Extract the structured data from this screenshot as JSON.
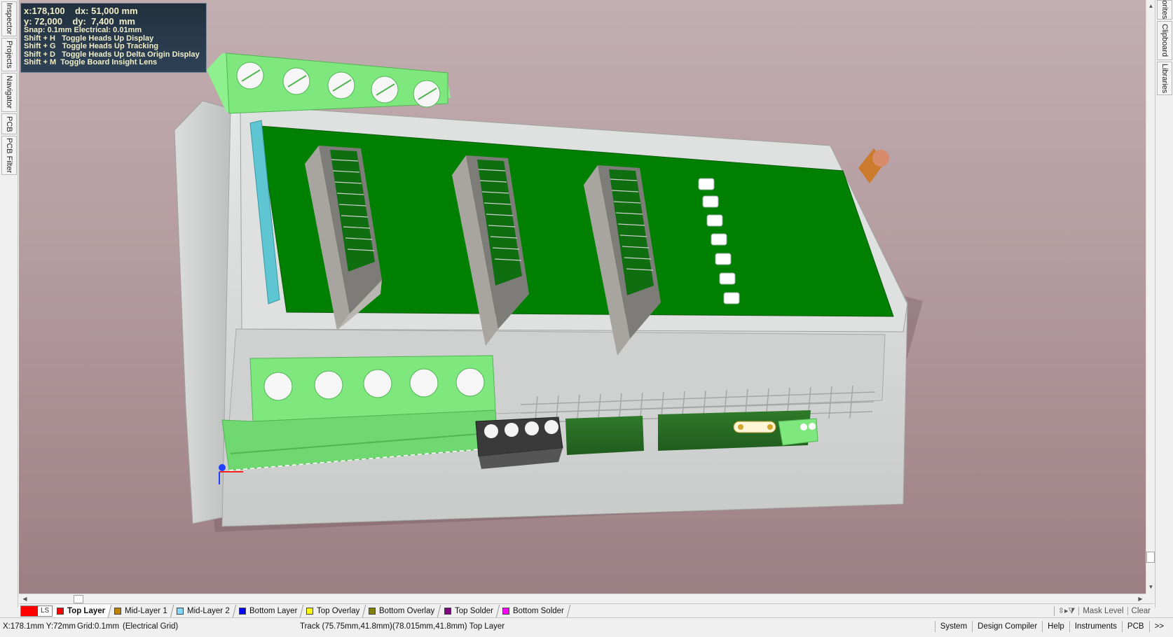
{
  "side_tabs_left": [
    "Inspector",
    "Projects",
    "Navigator",
    "PCB",
    "PCB Filter"
  ],
  "side_tabs_right": [
    "Favorites",
    "Clipboard",
    "Libraries"
  ],
  "hud": {
    "line1": "x:178,100    dx: 51,000 mm",
    "line2": "y: 72,000    dy:  7,400  mm",
    "lines": [
      "Snap: 0.1mm Electrical: 0.01mm",
      "Shift + H   Toggle Heads Up Display",
      "Shift + G   Toggle Heads Up Tracking",
      "Shift + D   Toggle Heads Up Delta Origin Display",
      "Shift + M  Toggle Board Insight Lens"
    ]
  },
  "layer_set_label": "LS",
  "layers": [
    {
      "name": "Top Layer",
      "color": "#ff0000",
      "active": true
    },
    {
      "name": "Mid-Layer 1",
      "color": "#c08000",
      "active": false
    },
    {
      "name": "Mid-Layer 2",
      "color": "#80d8ff",
      "active": false
    },
    {
      "name": "Bottom Layer",
      "color": "#0000ff",
      "active": false
    },
    {
      "name": "Top Overlay",
      "color": "#ffff00",
      "active": false
    },
    {
      "name": "Bottom Overlay",
      "color": "#808000",
      "active": false
    },
    {
      "name": "Top Solder",
      "color": "#800080",
      "active": false
    },
    {
      "name": "Bottom Solder",
      "color": "#ff00ff",
      "active": false
    }
  ],
  "layer_bar_right": {
    "snap_icons": "⇳▸⧩",
    "mask_level": "Mask Level",
    "clear": "Clear"
  },
  "status": {
    "coords": "X:178.1mm Y:72mm",
    "grid": "Grid:0.1mm",
    "grid_type": "(Electrical Grid)",
    "track_info": "Track (75.75mm,41.8mm)(78.015mm,41.8mm)  Top Layer"
  },
  "status_buttons": [
    "System",
    "Design Compiler",
    "Help",
    "Instruments",
    "PCB",
    ">>"
  ],
  "scroll_arrows": {
    "up": "▲",
    "down": "▼",
    "left": "◀",
    "right": "▶"
  },
  "model_colors": {
    "pcb": "#008000",
    "enclosure": "#d4d6d6",
    "terminal_block": "#7ee87e",
    "header": "#9a9a9a",
    "led": "#ffffff",
    "cable": "#d07a2a"
  }
}
